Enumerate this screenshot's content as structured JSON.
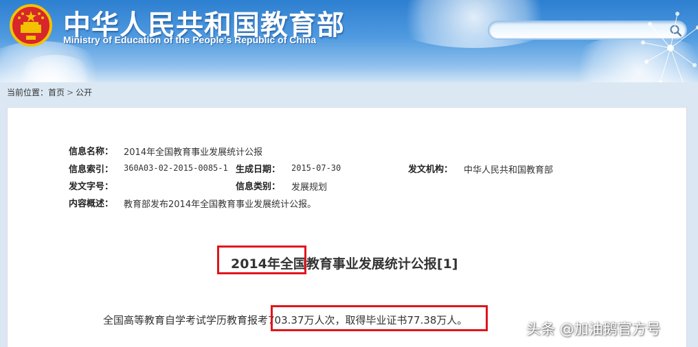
{
  "header": {
    "title_cn": "中华人民共和国教育部",
    "title_en": "Ministry of Education of the People's Republic of China",
    "emblem_icon": "national-emblem-icon",
    "search": {
      "value": "",
      "icon": "search-icon"
    }
  },
  "breadcrumb": {
    "prefix": "当前位置：",
    "items": [
      "首页",
      "公开"
    ],
    "separator": ">"
  },
  "meta": {
    "name_label": "信息名称：",
    "name_value": "2014年全国教育事业发展统计公报",
    "index_label": "信息索引：",
    "index_value": "360A03-02-2015-0085-1",
    "date_label": "生成日期：",
    "date_value": "2015-07-30",
    "issuer_label": "发文机构：",
    "issuer_value": "中华人民共和国教育部",
    "docno_label": "发文字号：",
    "docno_value": "",
    "category_label": "信息类别：",
    "category_value": "发展规划",
    "summary_label": "内容概述：",
    "summary_value": "教育部发布2014年全国教育事业发展统计公报。"
  },
  "document": {
    "title": "2014年全国教育事业发展统计公报[1]",
    "body": "全国高等教育自学考试学历教育报考703.37万人次，取得毕业证书77.38万人。"
  },
  "watermark": "头条 @加油鹅官方号",
  "colors": {
    "header_blue": "#2d7fd0",
    "highlight_red": "#e0141b",
    "page_bg": "#dbe8f4"
  }
}
